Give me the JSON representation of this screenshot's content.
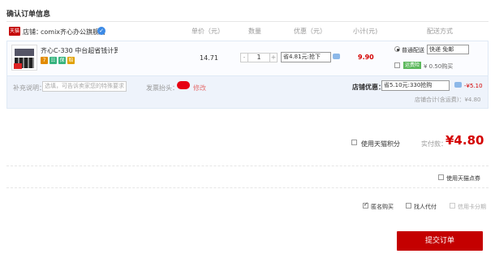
{
  "page_title": "确认订单信息",
  "header": {
    "store_tag": "天猫",
    "store_label": "店铺：",
    "store_name": "comix齐心办公旗舰店",
    "unit_price": "单价（元）",
    "quantity": "数量",
    "discount": "优惠（元）",
    "subtotal": "小计(元)",
    "shipping": "配送方式"
  },
  "item": {
    "name": "齐心C-330 中台超省钱计算...",
    "badges": [
      "7",
      "☷",
      "保",
      "赔"
    ],
    "price": "14.71",
    "quantity": "1",
    "minus": "-",
    "plus": "+",
    "promo": "省4.81元:抢下",
    "subtotal": "9.90"
  },
  "shipping": {
    "option_normal": "普通配送",
    "option_normal_select": "快递 免邮",
    "freight_tag": "运费险",
    "freight_price": "¥ 0.50购买"
  },
  "remark": {
    "label": "补充说明：",
    "placeholder": "选填，可告诉卖家您的特殊要求",
    "invoice_label": "发票抬头：",
    "invoice_link": "修改"
  },
  "store_promo": {
    "label": "店铺优惠：",
    "select": "省5.10元:330抢购",
    "discount": "-¥5.10",
    "total": "店铺合计(含运费)：¥4.80"
  },
  "summary": {
    "tmall_points": "使用天猫积分",
    "paid_label": "实付款：",
    "paid_amount": "¥4.80",
    "tmall_coupon": "使用天猫点券"
  },
  "options": {
    "anonymous": "匿名购买",
    "proxy": "找人代付",
    "credit_installment": "信用卡分期"
  },
  "submit": "提交订单",
  "colors": {
    "accent": "#c40000",
    "price_red": "#d40000"
  }
}
